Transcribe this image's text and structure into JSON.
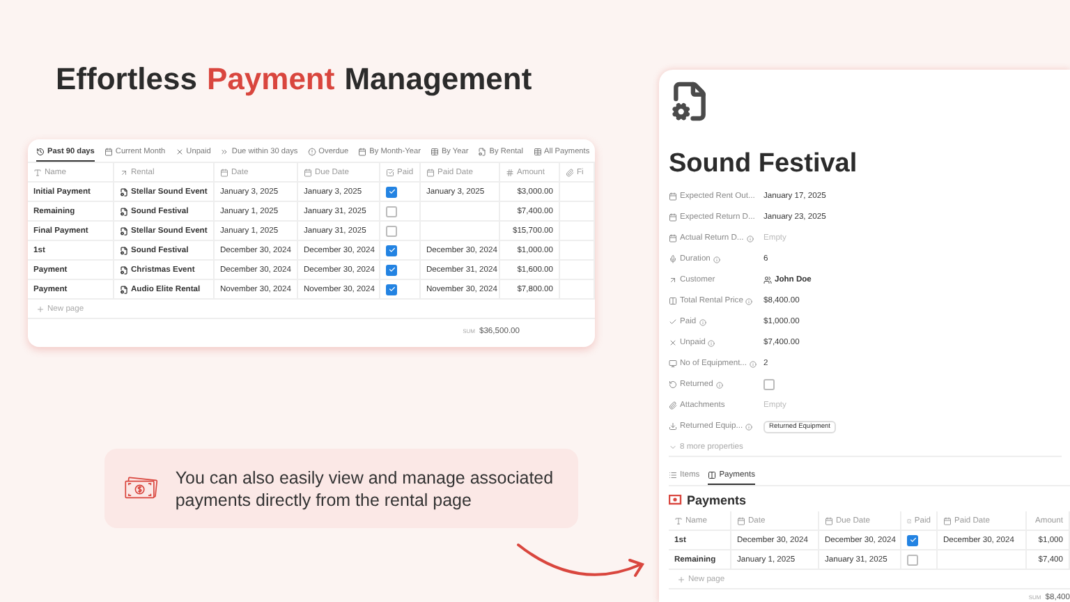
{
  "headline": [
    {
      "text": "Effortless",
      "accent": false
    },
    {
      "text": "Payment",
      "accent": true
    },
    {
      "text": "Management",
      "accent": false
    }
  ],
  "payments_table": {
    "views": [
      {
        "label": "Past 90 days",
        "kind": "history",
        "selected": true
      },
      {
        "label": "Current Month",
        "kind": "calendar",
        "selected": false
      },
      {
        "label": "Unpaid",
        "kind": "x",
        "selected": false
      },
      {
        "label": "Due within 30 days",
        "kind": "forward",
        "selected": false
      },
      {
        "label": "Overdue",
        "kind": "alert",
        "selected": false
      },
      {
        "label": "By Month-Year",
        "kind": "calendar",
        "selected": false
      },
      {
        "label": "By Year",
        "kind": "table",
        "selected": false
      },
      {
        "label": "By Rental",
        "kind": "file",
        "selected": false
      },
      {
        "label": "All Payments",
        "kind": "table",
        "selected": false
      }
    ],
    "columns": [
      {
        "label": "Name",
        "kind": "title"
      },
      {
        "label": "Rental",
        "kind": "relation"
      },
      {
        "label": "Date",
        "kind": "date"
      },
      {
        "label": "Due Date",
        "kind": "date"
      },
      {
        "label": "Paid",
        "kind": "checkbox"
      },
      {
        "label": "Paid Date",
        "kind": "date"
      },
      {
        "label": "Amount",
        "kind": "number"
      },
      {
        "label": "Fi",
        "kind": "file"
      }
    ],
    "rows": [
      {
        "name": "Initial Payment",
        "rental": "Stellar Sound Event",
        "date": "January 3, 2025",
        "due_date": "January 3, 2025",
        "paid": true,
        "paid_date": "January 3, 2025",
        "amount": "$3,000.00"
      },
      {
        "name": "Remaining",
        "rental": "Sound Festival",
        "date": "January 1, 2025",
        "due_date": "January 31, 2025",
        "paid": false,
        "paid_date": "",
        "amount": "$7,400.00"
      },
      {
        "name": "Final Payment",
        "rental": "Stellar Sound Event",
        "date": "January 1, 2025",
        "due_date": "January 31, 2025",
        "paid": false,
        "paid_date": "",
        "amount": "$15,700.00"
      },
      {
        "name": "1st",
        "rental": "Sound Festival",
        "date": "December 30, 2024",
        "due_date": "December 30, 2024",
        "paid": true,
        "paid_date": "December 30, 2024",
        "amount": "$1,000.00"
      },
      {
        "name": "Payment",
        "rental": "Christmas Event",
        "date": "December 30, 2024",
        "due_date": "December 30, 2024",
        "paid": true,
        "paid_date": "December 31, 2024",
        "amount": "$1,600.00"
      },
      {
        "name": "Payment",
        "rental": "Audio Elite Rental",
        "date": "November 30, 2024",
        "due_date": "November 30, 2024",
        "paid": true,
        "paid_date": "November 30, 2024",
        "amount": "$7,800.00"
      }
    ],
    "new_page": "New page",
    "sum_label": "SUM",
    "sum_value": "$36,500.00"
  },
  "callout": {
    "text": "You can also easily view and manage associated payments directly from the rental page"
  },
  "rental_page": {
    "title": "Sound Festival",
    "properties": [
      {
        "label": "Expected Rent Out...",
        "kind": "calendar-text",
        "info": false,
        "value": "January 17, 2025"
      },
      {
        "label": "Expected Return D...",
        "kind": "calendar-text",
        "info": false,
        "value": "January 23, 2025"
      },
      {
        "label": "Actual Return D...",
        "kind": "calendar-empty",
        "info": true,
        "value": "Empty"
      },
      {
        "label": "Duration",
        "kind": "mic-text",
        "info": true,
        "value": "6"
      },
      {
        "label": "Customer",
        "kind": "relation-person",
        "info": false,
        "value": "John Doe"
      },
      {
        "label": "Total Rental Price",
        "kind": "columns-text",
        "info": true,
        "value": "$8,400.00"
      },
      {
        "label": "Paid",
        "kind": "check-text",
        "info": true,
        "value": "$1,000.00"
      },
      {
        "label": "Unpaid",
        "kind": "x-text",
        "info": true,
        "value": "$7,400.00"
      },
      {
        "label": "No of Equipment...",
        "kind": "monitor-text",
        "info": true,
        "value": "2"
      },
      {
        "label": "Returned",
        "kind": "undo-checkbox",
        "info": true,
        "checked": false
      },
      {
        "label": "Attachments",
        "kind": "clip-empty",
        "info": false,
        "value": "Empty"
      },
      {
        "label": "Returned Equip...",
        "kind": "download-tag",
        "info": true,
        "value": "Returned Equipment"
      }
    ],
    "more_properties": "8 more properties",
    "tabs": [
      {
        "label": "Items",
        "kind": "list",
        "selected": false
      },
      {
        "label": "Payments",
        "kind": "columns",
        "selected": true
      }
    ],
    "section_title": "Payments",
    "columns": [
      {
        "label": "Name",
        "kind": "title"
      },
      {
        "label": "Date",
        "kind": "date"
      },
      {
        "label": "Due Date",
        "kind": "date"
      },
      {
        "label": "Paid",
        "kind": "checkbox"
      },
      {
        "label": "Paid Date",
        "kind": "date"
      },
      {
        "label": "Amount",
        "kind": "number"
      }
    ],
    "rows": [
      {
        "name": "1st",
        "date": "December 30, 2024",
        "due_date": "December 30, 2024",
        "paid": true,
        "paid_date": "December 30, 2024",
        "amount": "$1,000"
      },
      {
        "name": "Remaining",
        "date": "January 1, 2025",
        "due_date": "January 31, 2025",
        "paid": false,
        "paid_date": "",
        "amount": "$7,400"
      }
    ],
    "new_page": "New page",
    "sum_label": "SUM",
    "sum_value": "$8,400"
  }
}
